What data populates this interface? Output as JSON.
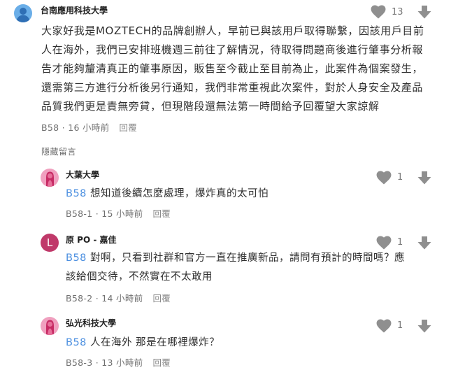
{
  "main_comment": {
    "author": "台南應用科技大學",
    "body_lines": [
      "大家好我是MOZTECH的品牌創辦人，早前已與該用戶取得聯繫，因該用戶目前",
      "人在海外，我們已安排班機週三前往了解情況，待取得問題商後進行肇事分析報",
      "告才能夠釐清真正的肇事原因，販售至今截止至目前為止，此案件為個案發生，",
      "還需第三方進行分析後另行通知，我們非常重視此次案件，對於人身安全及產品",
      "品質我們更是責無旁貸，但現階段還無法第一時間給予回覆望大家諒解"
    ],
    "floor": "B58",
    "time": "16 小時前",
    "reply_label": "回覆",
    "likes": "13"
  },
  "hide_replies_label": "隱藏留言",
  "replies": [
    {
      "author": "大葉大學",
      "tag": "B58",
      "text_lines": [
        "想知道後續怎麼處理，爆炸真的太可怕"
      ],
      "floor": "B58-1",
      "time": "15 小時前",
      "reply_label": "回覆",
      "likes": "1"
    },
    {
      "author": "原 PO - 嘉佳",
      "avatar_letter": "L",
      "tag": "B58",
      "text_lines": [
        "對啊，只看到社群和官方一直在推廣新品，請問有預計的時間嗎？應",
        "該給個交待，不然實在不太敢用"
      ],
      "floor": "B58-2",
      "time": "14 小時前",
      "reply_label": "回覆",
      "likes": "1"
    },
    {
      "author": "弘光科技大學",
      "tag": "B58",
      "text_lines": [
        "人在海外 那是在哪裡爆炸？"
      ],
      "floor": "B58-3",
      "time": "13 小時前",
      "reply_label": "回覆",
      "likes": "1"
    }
  ],
  "colors": {
    "tag": "#4b8fe0",
    "icon": "#8f8f8f",
    "avatar_blue": "#6aaee8",
    "avatar_pink": "#e4709a",
    "avatar_L": "#c0396a"
  }
}
